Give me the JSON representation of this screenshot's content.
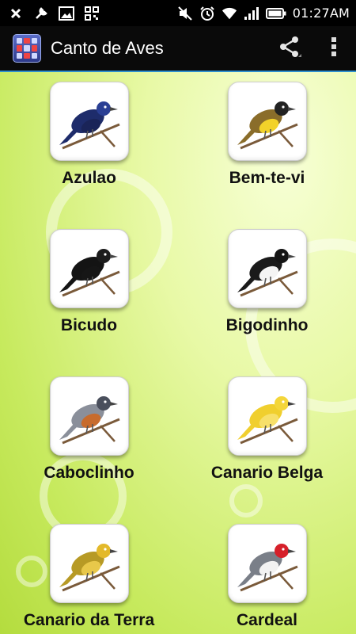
{
  "status_bar": {
    "time": "01:27AM",
    "left_icons": [
      "close-icon",
      "wrench-icon",
      "image-icon",
      "qr-icon"
    ],
    "right_icons": [
      "mute-icon",
      "alarm-icon",
      "wifi-icon",
      "signal-icon",
      "battery-icon"
    ]
  },
  "action_bar": {
    "title": "Canto de Aves",
    "actions": [
      "share-icon",
      "overflow-menu-icon"
    ]
  },
  "birds": [
    {
      "name": "Azulao",
      "colors": {
        "body": "#1e2c6b",
        "head": "#2a3f94",
        "belly": "#1a2458"
      }
    },
    {
      "name": "Bem-te-vi",
      "colors": {
        "body": "#8a6d2a",
        "head": "#222222",
        "belly": "#f2d22a"
      }
    },
    {
      "name": "Bicudo",
      "colors": {
        "body": "#141414",
        "head": "#1c1c1c",
        "belly": "#161616"
      }
    },
    {
      "name": "Bigodinho",
      "colors": {
        "body": "#1a1a1a",
        "head": "#151515",
        "belly": "#f4f4f4"
      }
    },
    {
      "name": "Caboclinho",
      "colors": {
        "body": "#8a8f9a",
        "head": "#4a4f5c",
        "belly": "#c76b2d"
      }
    },
    {
      "name": "Canario Belga",
      "colors": {
        "body": "#f0cf2e",
        "head": "#f4d63a",
        "belly": "#f7e06a"
      }
    },
    {
      "name": "Canario da Terra",
      "colors": {
        "body": "#b79a25",
        "head": "#e3b92a",
        "belly": "#e8c84a"
      }
    },
    {
      "name": "Cardeal",
      "colors": {
        "body": "#7a7f88",
        "head": "#d6202a",
        "belly": "#f2f2f2"
      }
    }
  ]
}
